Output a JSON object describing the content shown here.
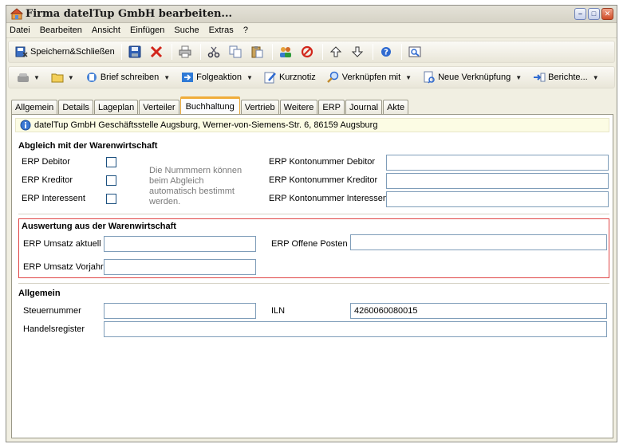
{
  "window": {
    "title": "Firma datelTup GmbH bearbeiten...",
    "controls": {
      "minimize": "–",
      "maximize": "□",
      "close": "✕"
    }
  },
  "menu": [
    "Datei",
    "Bearbeiten",
    "Ansicht",
    "Einfügen",
    "Suche",
    "Extras",
    "?"
  ],
  "toolbar1": {
    "save_close": "Speichern&Schließen"
  },
  "toolbar2": {
    "letter": "Brief schreiben",
    "followup": "Folgeaktion",
    "note": "Kurznotiz",
    "link_with": "Verknüpfen mit",
    "new_link": "Neue Verknüpfung",
    "reports": "Berichte..."
  },
  "tabs": [
    "Allgemein",
    "Details",
    "Lageplan",
    "Verteiler",
    "Buchhaltung",
    "Vertrieb",
    "Weitere",
    "ERP",
    "Journal",
    "Akte"
  ],
  "active_tab": "Buchhaltung",
  "info": "datelTup GmbH Geschäftsstelle Augsburg,  Werner-von-Siemens-Str. 6,  86159 Augsburg",
  "sync": {
    "title": "Abgleich mit der Warenwirtschaft",
    "debitor": "ERP Debitor",
    "kreditor": "ERP Kreditor",
    "interessent": "ERP Interessent",
    "note": "Die Nummmern können beim Abgleich automatisch bestimmt werden.",
    "acct_debitor": "ERP Kontonummer Debitor",
    "acct_kreditor": "ERP Kontonummer Kreditor",
    "acct_interessent": "ERP Kontonummer Interessent",
    "acct_debitor_value": "",
    "acct_kreditor_value": "",
    "acct_interessent_value": ""
  },
  "eval": {
    "title": "Auswertung aus der Warenwirtschaft",
    "revenue_current": "ERP Umsatz aktuell",
    "revenue_prev": "ERP Umsatz Vorjahr",
    "open_items": "ERP Offene Posten",
    "revenue_current_value": "",
    "revenue_prev_value": "",
    "open_items_value": ""
  },
  "general": {
    "title": "Allgemein",
    "tax_no": "Steuernummer",
    "iln": "ILN",
    "register": "Handelsregister",
    "tax_no_value": "",
    "iln_value": "4260060080015",
    "register_value": ""
  }
}
